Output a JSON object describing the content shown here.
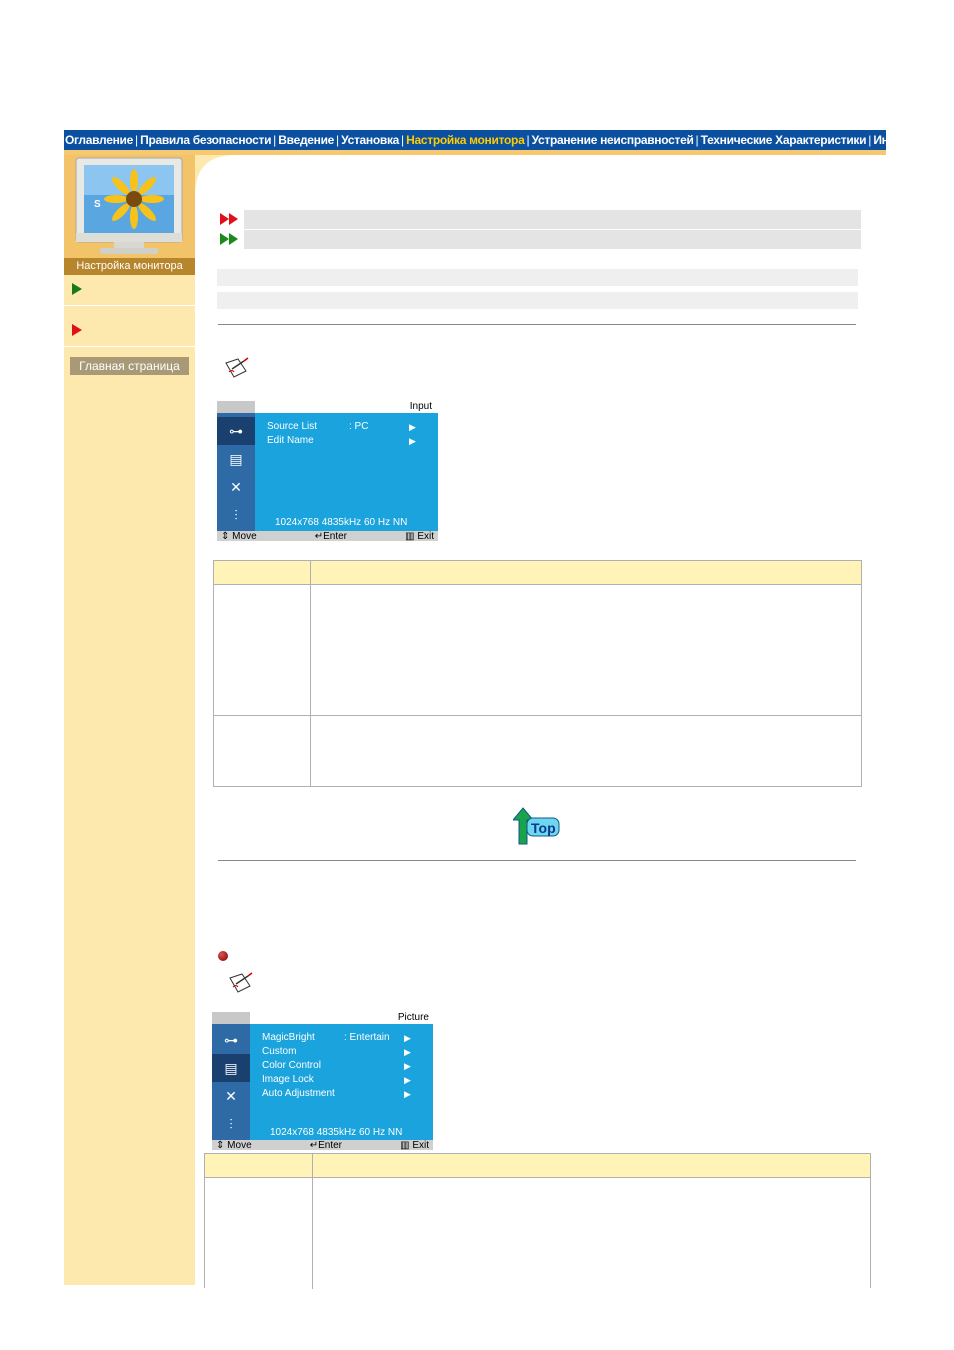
{
  "nav": {
    "items": [
      {
        "label": "Оглавление",
        "active": false
      },
      {
        "label": "Правила безопасности",
        "active": false
      },
      {
        "label": "Введение",
        "active": false
      },
      {
        "label": "Установка",
        "active": false
      },
      {
        "label": "Настройка монитора",
        "active": true
      },
      {
        "label": "Устранение неисправностей",
        "active": false
      },
      {
        "label": "Технические Характеристики",
        "active": false
      },
      {
        "label": "Информации",
        "active": false
      }
    ],
    "separator": "|"
  },
  "sidebar": {
    "title": "Настройка монитора",
    "home_label": "Главная страница",
    "monitor_letter": "S"
  },
  "osd1": {
    "header": "Input",
    "menu": [
      {
        "label": "Source List",
        "value": ": PC",
        "arrow": "▶"
      },
      {
        "label": "Edit Name",
        "value": "",
        "arrow": "▶"
      }
    ],
    "status": "1024x768     4835kHz     60 Hz   NN",
    "footer": {
      "move": "Move",
      "enter": "Enter",
      "exit": "Exit"
    }
  },
  "osd2": {
    "header": "Picture",
    "menu": [
      {
        "label": "MagicBright",
        "value": ": Entertain",
        "arrow": "▶"
      },
      {
        "label": "Custom",
        "value": "",
        "arrow": "▶"
      },
      {
        "label": "Color Control",
        "value": "",
        "arrow": "▶"
      },
      {
        "label": "Image Lock",
        "value": "",
        "arrow": "▶"
      },
      {
        "label": "Auto Adjustment",
        "value": "",
        "arrow": "▶"
      }
    ],
    "status": "1024x768     4835kHz     60 Hz   NN",
    "footer": {
      "move": "Move",
      "enter": "Enter",
      "exit": "Exit"
    }
  },
  "top_button": "Top",
  "colors": {
    "nav_bg": "#0a4fa0",
    "nav_active": "#ffcc00",
    "sidebar_bg": "#fde9ad",
    "osd_panel": "#1aa3dc",
    "table_header": "#fff3b8"
  }
}
